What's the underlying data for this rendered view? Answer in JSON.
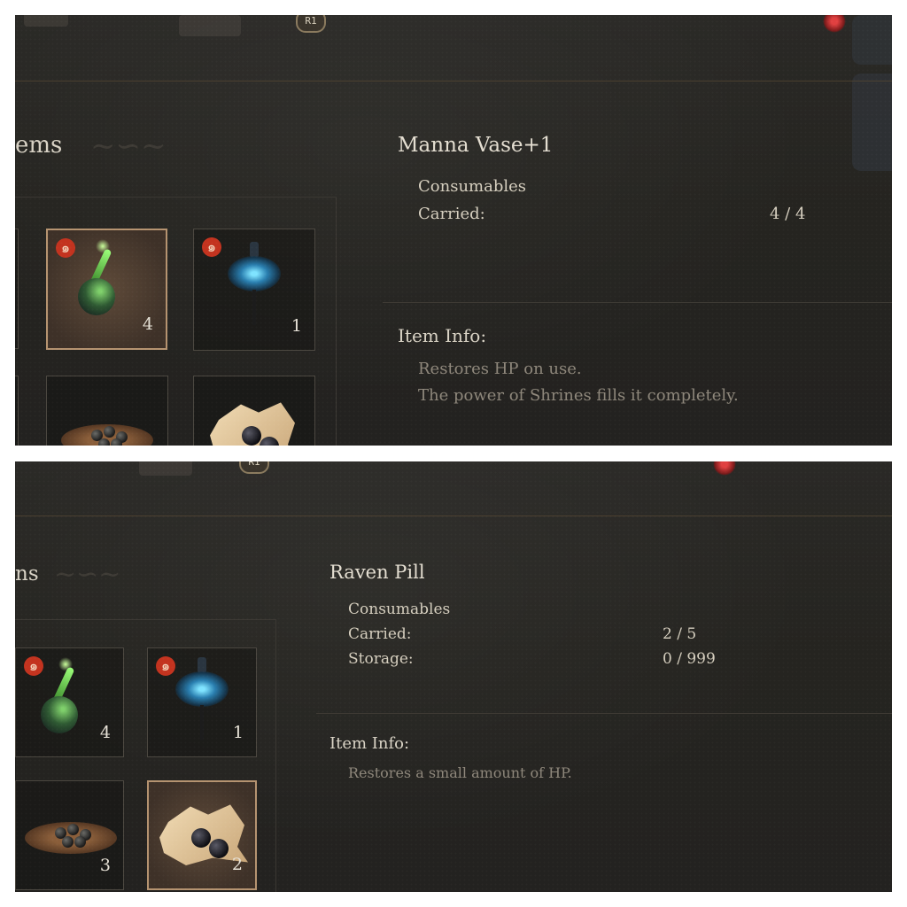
{
  "top_panel": {
    "r1_badge": "R1",
    "section_title": "ems",
    "items": [
      {
        "count": "4",
        "marked": true,
        "mark_icon": "spiral-icon",
        "art": "vase"
      },
      {
        "count": "1",
        "marked": true,
        "mark_icon": "spiral-icon",
        "art": "lantern"
      },
      {
        "count": "",
        "marked": false,
        "art": "pills-bowl"
      },
      {
        "count": "",
        "marked": false,
        "art": "paper"
      }
    ],
    "selected_index": 0,
    "info": {
      "name": "Manna Vase+1",
      "category": "Consumables",
      "carried_label": "Carried:",
      "carried_value": "4 / 4",
      "item_info_heading": "Item Info:",
      "desc_lines": [
        "Restores HP on use.",
        "The power of Shrines fills it completely."
      ]
    }
  },
  "bottom_panel": {
    "r1_badge": "R1",
    "section_title": "ns",
    "items": [
      {
        "count": "4",
        "marked": true,
        "mark_icon": "spiral-icon",
        "art": "vase"
      },
      {
        "count": "1",
        "marked": true,
        "mark_icon": "spiral-icon",
        "art": "lantern"
      },
      {
        "count": "3",
        "marked": false,
        "art": "pills-bowl"
      },
      {
        "count": "2",
        "marked": false,
        "art": "paper"
      }
    ],
    "selected_index": 3,
    "info": {
      "name": "Raven Pill",
      "category": "Consumables",
      "carried_label": "Carried:",
      "carried_value": "2 / 5",
      "storage_label": "Storage:",
      "storage_value": "0 / 999",
      "item_info_heading": "Item Info:",
      "desc_lines": [
        "Restores a small amount of HP."
      ]
    }
  },
  "colors": {
    "selected_border": "#b59370",
    "mark_red": "#c3331f",
    "text_primary": "#e4ded1",
    "text_muted": "#8e877b"
  }
}
